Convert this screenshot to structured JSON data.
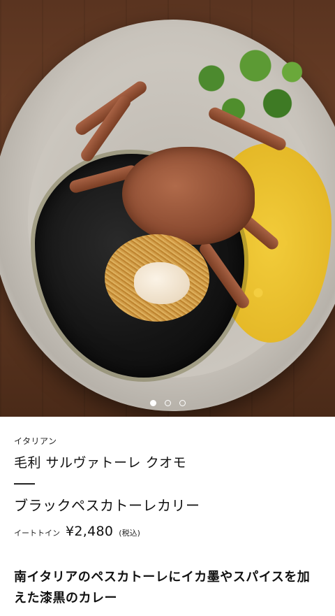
{
  "hero": {
    "image_icon": "food-photo-black-pescatore-curry",
    "carousel": {
      "total": 3,
      "active_index": 0
    }
  },
  "restaurant": {
    "genre": "イタリアン",
    "name": "毛利 サルヴァトーレ クオモ"
  },
  "menu_item": {
    "name": "ブラックペスカトーレカリー",
    "eat_in_label": "イートトイン",
    "price": "¥2,480",
    "tax_note": "(税込)",
    "description": "南イタリアのペスカトーレにイカ墨やスパイスを加えた漆黒のカレー"
  },
  "colors": {
    "text": "#111111",
    "background": "#ffffff",
    "dot_active": "#ffffff"
  }
}
